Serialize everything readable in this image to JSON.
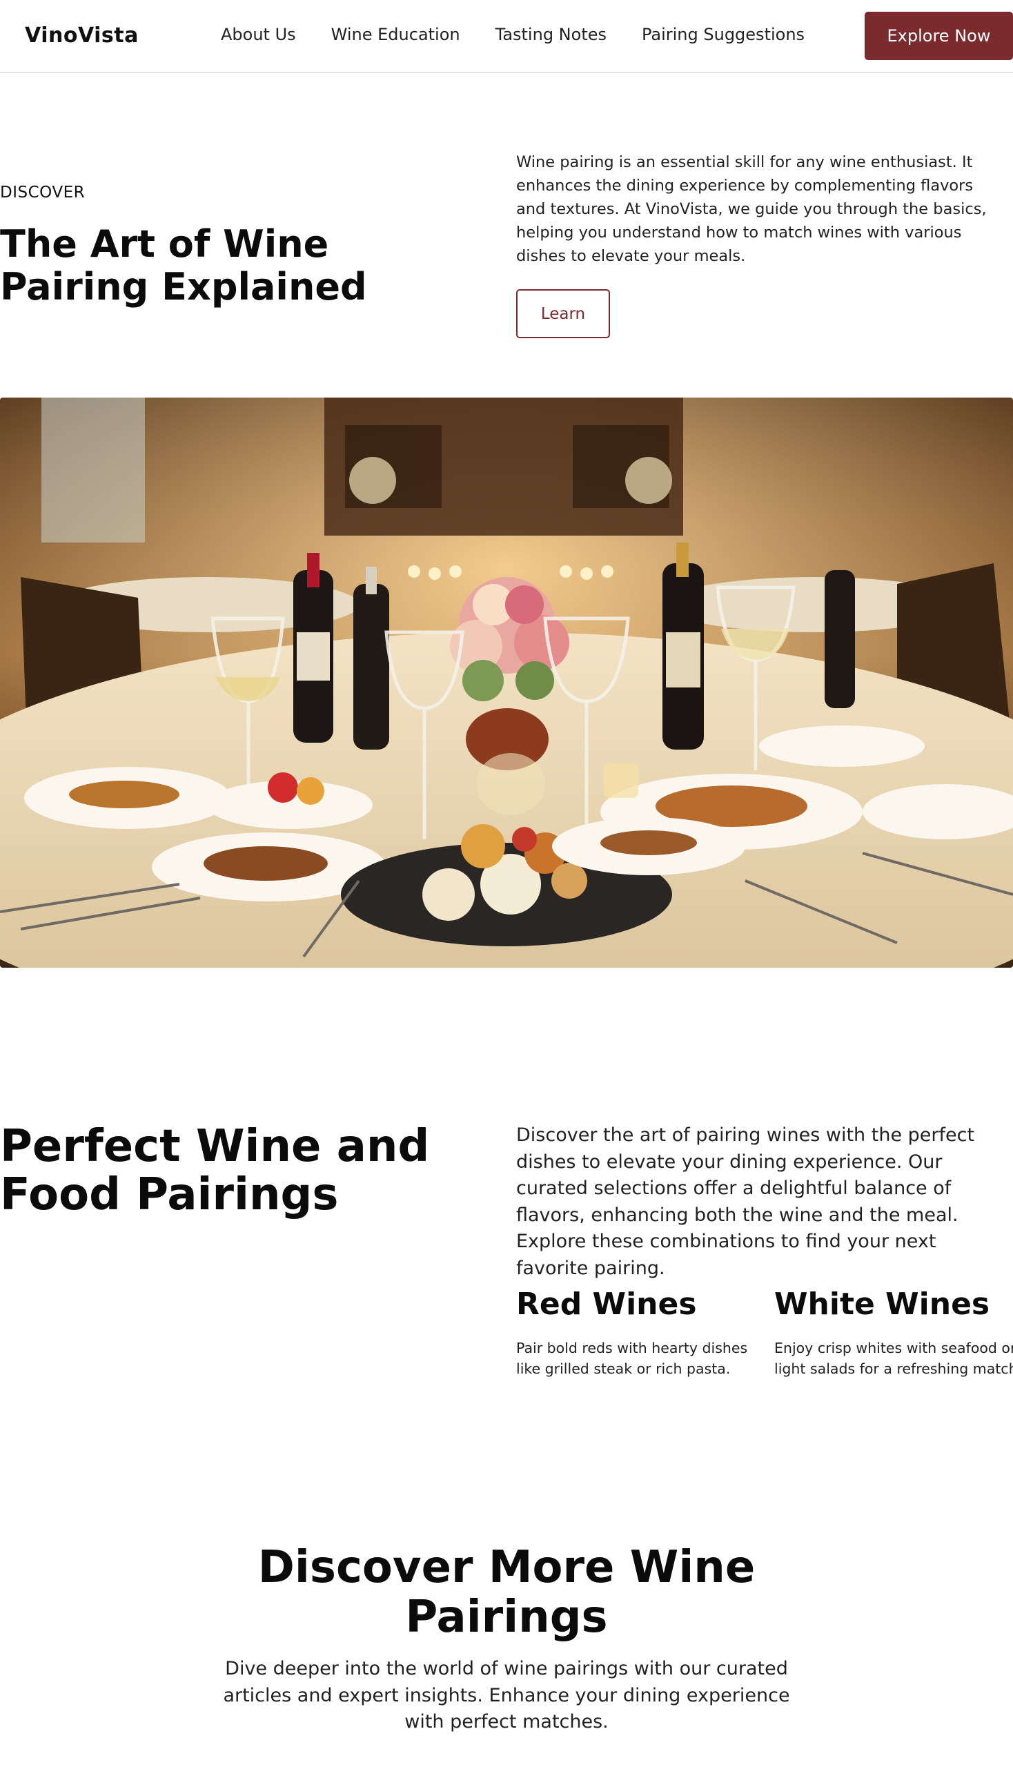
{
  "header": {
    "logo": "VinoVista",
    "nav": [
      "About Us",
      "Wine Education",
      "Tasting Notes",
      "Pairing Suggestions"
    ],
    "cta_label": "Explore Now"
  },
  "hero": {
    "eyebrow": "DISCOVER",
    "title": "The Art of Wine Pairing Explained",
    "description": "Wine pairing is an essential skill for any wine enthusiast. It enhances the dining experience by complementing flavors and textures. At VinoVista, we guide you through the basics, helping you understand how to match wines with various dishes to elevate your meals.",
    "button_label": "Learn"
  },
  "image": {
    "subject": "restaurant-table-with-wine-and-dishes"
  },
  "pairings": {
    "title": "Perfect Wine and Food Pairings",
    "description": "Discover the art of pairing wines with the perfect dishes to elevate your dining experience. Our curated selections offer a delightful balance of flavors, enhancing both the wine and the meal. Explore these combinations to find your next favorite pairing.",
    "red": {
      "title": "Red Wines",
      "text": "Pair bold reds with hearty dishes like grilled steak or rich pasta."
    },
    "white": {
      "title": "White Wines",
      "text": "Enjoy crisp whites with seafood or light salads for a refreshing match."
    }
  },
  "more": {
    "title": "Discover More Wine Pairings",
    "description": "Dive deeper into the world of wine pairings with our curated articles and expert insights. Enhance your dining experience with perfect matches."
  },
  "colors": {
    "accent": "#7b2a2e",
    "text": "#111111",
    "border": "#e2e2e2"
  }
}
